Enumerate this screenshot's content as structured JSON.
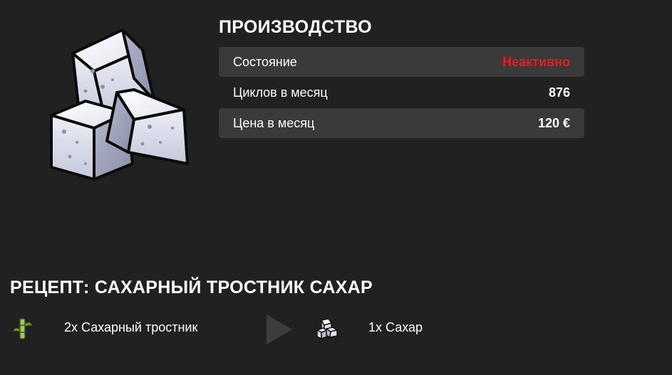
{
  "production": {
    "title": "ПРОИЗВОДСТВО",
    "image_icon": "sugar-cubes-icon",
    "stats": [
      {
        "label": "Состояние",
        "value": "Неактивно",
        "status_color": "#e41e1e"
      },
      {
        "label": "Циклов в месяц",
        "value": "876"
      },
      {
        "label": "Цена в месяц",
        "value": "120 €"
      }
    ]
  },
  "recipe": {
    "title": "РЕЦЕПТ: САХАРНЫЙ ТРОСТНИК САХАР",
    "input": {
      "label": "2x Сахарный тростник",
      "icon": "sugarcane-icon"
    },
    "arrow_icon": "arrow-right-icon",
    "output": {
      "label": "1x Сахар",
      "icon": "sugar-cubes-icon"
    }
  },
  "colors": {
    "background": "#212121",
    "row_shade": "#3a3a3a",
    "inactive": "#e41e1e"
  }
}
